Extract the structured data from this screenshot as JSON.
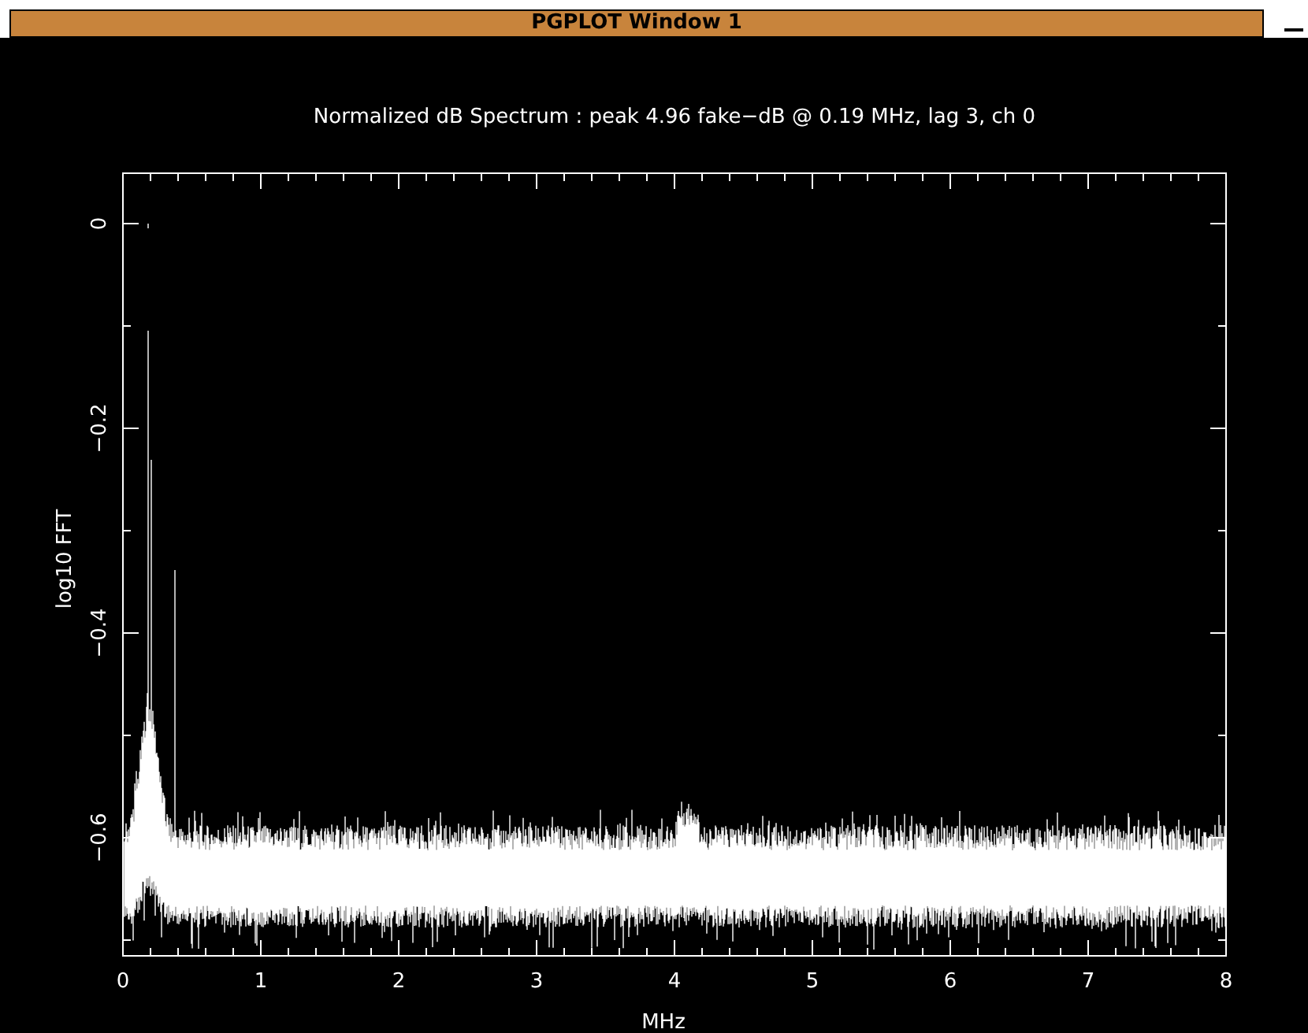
{
  "window": {
    "title": "PGPLOT Window 1"
  },
  "plot": {
    "title": "Normalized dB Spectrum : peak 4.96 fake−dB @ 0.19 MHz, lag 3, ch 0",
    "ylabel": "log10 FFT",
    "xlabel": "MHz",
    "xticks": [
      "0",
      "1",
      "2",
      "3",
      "4",
      "5",
      "6",
      "7",
      "8"
    ],
    "yticks": [
      "0",
      "−0.2",
      "−0.4",
      "−0.6"
    ]
  }
}
